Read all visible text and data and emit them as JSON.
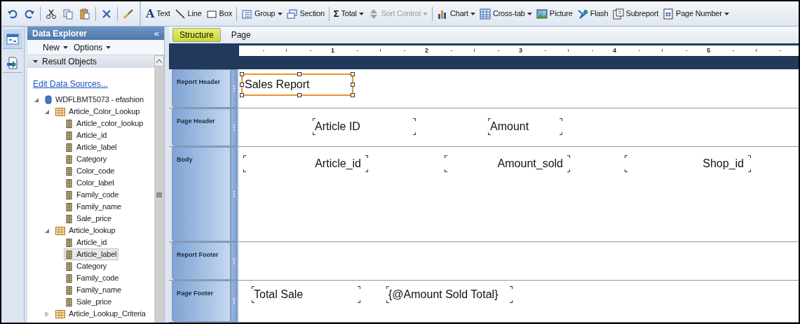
{
  "toolbar": {
    "edit_tools": [
      [
        {
          "kind": "undo"
        },
        {
          "kind": "redo"
        }
      ],
      [
        {
          "kind": "cut"
        },
        {
          "kind": "copy"
        },
        {
          "kind": "paste"
        }
      ],
      [
        {
          "kind": "delete"
        }
      ],
      [
        {
          "kind": "painter"
        }
      ]
    ],
    "insert_tools": [
      [
        {
          "kind": "text",
          "glyph": "A",
          "label": "Text",
          "dropdown": false,
          "disabled": false
        },
        {
          "kind": "line",
          "label": "Line",
          "dropdown": false,
          "disabled": false
        },
        {
          "kind": "box",
          "label": "Box",
          "dropdown": false,
          "disabled": false
        }
      ],
      [
        {
          "kind": "group",
          "label": "Group",
          "dropdown": true,
          "disabled": false
        },
        {
          "kind": "section",
          "label": "Section",
          "dropdown": false,
          "disabled": false
        }
      ],
      [
        {
          "kind": "total",
          "glyph": "Σ",
          "label": "Total",
          "dropdown": true,
          "disabled": false
        },
        {
          "kind": "sort",
          "label": "Sort Control",
          "dropdown": true,
          "disabled": true
        }
      ],
      [
        {
          "kind": "chart",
          "label": "Chart",
          "dropdown": true,
          "disabled": false
        },
        {
          "kind": "crosstab",
          "label": "Cross-tab",
          "dropdown": true,
          "disabled": false
        },
        {
          "kind": "picture",
          "label": "Picture",
          "dropdown": false,
          "disabled": false
        },
        {
          "kind": "flash",
          "label": "Flash",
          "dropdown": false,
          "disabled": false
        },
        {
          "kind": "subreport",
          "label": "Subreport",
          "dropdown": false,
          "disabled": false
        },
        {
          "kind": "pagenumber",
          "label": "Page Number",
          "dropdown": true,
          "disabled": false
        }
      ]
    ]
  },
  "rail": [
    {
      "kind": "explorer",
      "selected": true
    },
    {
      "kind": "report",
      "selected": false
    }
  ],
  "data_explorer": {
    "title": "Data Explorer",
    "collapse": "«",
    "menus": [
      "New",
      "Options"
    ],
    "section_title": "Result Objects",
    "link": "Edit Data Sources...",
    "tree": [
      {
        "kind": "database",
        "label": "WDFLBMT5073 - efashion",
        "expanded": true,
        "selected": false,
        "children": [
          {
            "kind": "table",
            "label": "Article_Color_Lookup",
            "expanded": true,
            "selected": false,
            "children": [
              {
                "kind": "column",
                "label": "Article_color_lookup",
                "selected": false
              },
              {
                "kind": "column",
                "label": "Article_id",
                "selected": false
              },
              {
                "kind": "column",
                "label": "Article_label",
                "selected": false
              },
              {
                "kind": "column",
                "label": "Category",
                "selected": false
              },
              {
                "kind": "column",
                "label": "Color_code",
                "selected": false
              },
              {
                "kind": "column",
                "label": "Color_label",
                "selected": false
              },
              {
                "kind": "column",
                "label": "Family_code",
                "selected": false
              },
              {
                "kind": "column",
                "label": "Family_name",
                "selected": false
              },
              {
                "kind": "column",
                "label": "Sale_price",
                "selected": false
              }
            ]
          },
          {
            "kind": "table",
            "label": "Article_lookup",
            "expanded": true,
            "selected": false,
            "children": [
              {
                "kind": "column",
                "label": "Article_id",
                "selected": false
              },
              {
                "kind": "column",
                "label": "Article_label",
                "selected": true
              },
              {
                "kind": "column",
                "label": "Category",
                "selected": false
              },
              {
                "kind": "column",
                "label": "Family_code",
                "selected": false
              },
              {
                "kind": "column",
                "label": "Family_name",
                "selected": false
              },
              {
                "kind": "column",
                "label": "Sale_price",
                "selected": false
              }
            ]
          },
          {
            "kind": "table",
            "label": "Article_Lookup_Criteria",
            "expanded": false,
            "selected": false
          }
        ]
      }
    ]
  },
  "design": {
    "tabs": [
      {
        "label": "Structure",
        "selected": true
      },
      {
        "label": "Page",
        "selected": false
      }
    ],
    "ruler": [
      "1",
      "2",
      "3",
      "4",
      "5"
    ],
    "sections": [
      {
        "label": "Report Header",
        "fields": [
          {
            "text": "Sales Report",
            "selected": true
          }
        ]
      },
      {
        "label": "Page Header",
        "fields": [
          {
            "text": "Article ID",
            "selected": false
          },
          {
            "text": "Amount",
            "selected": false
          }
        ]
      },
      {
        "label": "Body",
        "fields": [
          {
            "text": "Article_id",
            "selected": false
          },
          {
            "text": "Amount_sold",
            "selected": false
          },
          {
            "text": "Shop_id",
            "selected": false
          }
        ]
      },
      {
        "label": "Report Footer"
      },
      {
        "label": "Page Footer",
        "fields": [
          {
            "text": "Total Sale",
            "selected": false
          },
          {
            "text": "{@Amount Sold Total}",
            "selected": false
          }
        ]
      }
    ]
  }
}
